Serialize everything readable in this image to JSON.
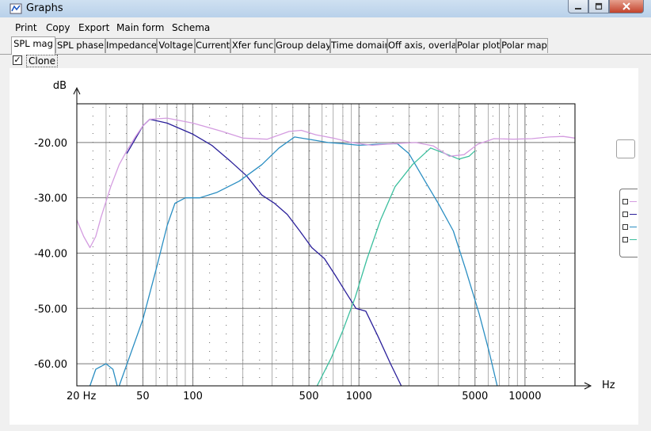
{
  "window": {
    "title": "Graphs"
  },
  "menu": [
    "Print",
    "Copy",
    "Export",
    "Main form",
    "Schema"
  ],
  "tabs": [
    "SPL mag",
    "SPL phase",
    "Impedance",
    "Voltage",
    "Current",
    "Xfer func",
    "Group delay",
    "Time domain",
    "Off axis, overlay",
    "Polar plot",
    "Polar map"
  ],
  "active_tab": "SPL mag",
  "clone": {
    "label": "Clone",
    "checked": true
  },
  "colors": {
    "navy": "#2a1f9a",
    "teal_blue": "#2a8ec2",
    "sea_green": "#3cbf9e",
    "lilac": "#d49ce0"
  },
  "chart_data": {
    "type": "line",
    "y_unit_label": "dB",
    "x_unit_label": "Hz",
    "x_scale": "log",
    "xlim": [
      20,
      20000
    ],
    "ylim": [
      -64,
      -13
    ],
    "grid": true,
    "y_ticks": [
      {
        "value": -20,
        "label": "-20.00"
      },
      {
        "value": -30,
        "label": "-30.00"
      },
      {
        "value": -40,
        "label": "-40.00"
      },
      {
        "value": -50,
        "label": "-50.00"
      },
      {
        "value": -60,
        "label": "-60.00"
      }
    ],
    "x_ticks": [
      {
        "value": 20,
        "label": "20 Hz"
      },
      {
        "value": 50,
        "label": "50"
      },
      {
        "value": 100,
        "label": "100"
      },
      {
        "value": 500,
        "label": "500"
      },
      {
        "value": 1000,
        "label": "1000"
      },
      {
        "value": 5000,
        "label": "5000"
      },
      {
        "value": 10000,
        "label": "10000"
      }
    ],
    "series": [
      {
        "color": "#2a1f9a",
        "points": [
          [
            40,
            -22
          ],
          [
            50,
            -17
          ],
          [
            55,
            -15.8
          ],
          [
            70,
            -16.5
          ],
          [
            100,
            -18.5
          ],
          [
            130,
            -20.5
          ],
          [
            170,
            -23.5
          ],
          [
            210,
            -26
          ],
          [
            260,
            -29.5
          ],
          [
            310,
            -31
          ],
          [
            370,
            -33
          ],
          [
            440,
            -36
          ],
          [
            520,
            -39
          ],
          [
            620,
            -41
          ],
          [
            720,
            -44
          ],
          [
            830,
            -47
          ],
          [
            960,
            -50
          ],
          [
            1100,
            -50.5
          ],
          [
            1300,
            -55
          ],
          [
            1550,
            -60
          ],
          [
            1800,
            -64
          ]
        ]
      },
      {
        "color": "#2a8ec2",
        "points": [
          [
            36,
            -64
          ],
          [
            50,
            -52
          ],
          [
            60,
            -43
          ],
          [
            70,
            -35
          ],
          [
            78,
            -31
          ],
          [
            90,
            -30
          ],
          [
            110,
            -30
          ],
          [
            140,
            -29
          ],
          [
            190,
            -27
          ],
          [
            260,
            -24
          ],
          [
            330,
            -21
          ],
          [
            410,
            -19
          ],
          [
            520,
            -19.5
          ],
          [
            650,
            -20
          ],
          [
            800,
            -20.2
          ],
          [
            1000,
            -20.5
          ],
          [
            1300,
            -20.3
          ],
          [
            1700,
            -20.2
          ],
          [
            2000,
            -22
          ],
          [
            2500,
            -27
          ],
          [
            3000,
            -31
          ],
          [
            3700,
            -36
          ],
          [
            4400,
            -43
          ],
          [
            5300,
            -51
          ],
          [
            6100,
            -58
          ],
          [
            6800,
            -64
          ]
        ]
      },
      {
        "color": "#2a8ec2",
        "points": [
          [
            24,
            -64
          ],
          [
            26,
            -61
          ],
          [
            30,
            -60
          ],
          [
            33,
            -61
          ],
          [
            35,
            -64
          ]
        ]
      },
      {
        "color": "#3cbf9e",
        "points": [
          [
            560,
            -64
          ],
          [
            680,
            -59
          ],
          [
            800,
            -54
          ],
          [
            950,
            -48
          ],
          [
            1120,
            -41
          ],
          [
            1350,
            -34
          ],
          [
            1650,
            -28
          ],
          [
            2100,
            -24
          ],
          [
            2700,
            -21
          ],
          [
            3300,
            -22
          ],
          [
            4000,
            -23
          ],
          [
            4600,
            -22.5
          ],
          [
            5000,
            -21.5
          ]
        ]
      },
      {
        "color": "#d49ce0",
        "points": [
          [
            20,
            -34
          ],
          [
            22,
            -37
          ],
          [
            24,
            -39
          ],
          [
            26,
            -37
          ],
          [
            28,
            -33.5
          ],
          [
            32,
            -28
          ],
          [
            36,
            -24
          ],
          [
            40,
            -21.5
          ],
          [
            45,
            -19
          ],
          [
            50,
            -17
          ],
          [
            55,
            -15.8
          ],
          [
            70,
            -15.6
          ],
          [
            100,
            -16.5
          ],
          [
            150,
            -18
          ],
          [
            200,
            -19.2
          ],
          [
            280,
            -19.4
          ],
          [
            380,
            -18
          ],
          [
            450,
            -17.8
          ],
          [
            550,
            -18.6
          ],
          [
            700,
            -19.2
          ],
          [
            900,
            -20
          ],
          [
            1200,
            -20.5
          ],
          [
            1600,
            -20.2
          ],
          [
            2200,
            -20
          ],
          [
            2800,
            -20.6
          ],
          [
            3500,
            -22.5
          ],
          [
            4300,
            -22.2
          ],
          [
            5200,
            -20.3
          ],
          [
            6500,
            -19.3
          ],
          [
            8500,
            -19.4
          ],
          [
            11000,
            -19.3
          ],
          [
            14000,
            -19
          ],
          [
            17000,
            -18.9
          ],
          [
            20000,
            -19.2
          ]
        ]
      }
    ]
  }
}
